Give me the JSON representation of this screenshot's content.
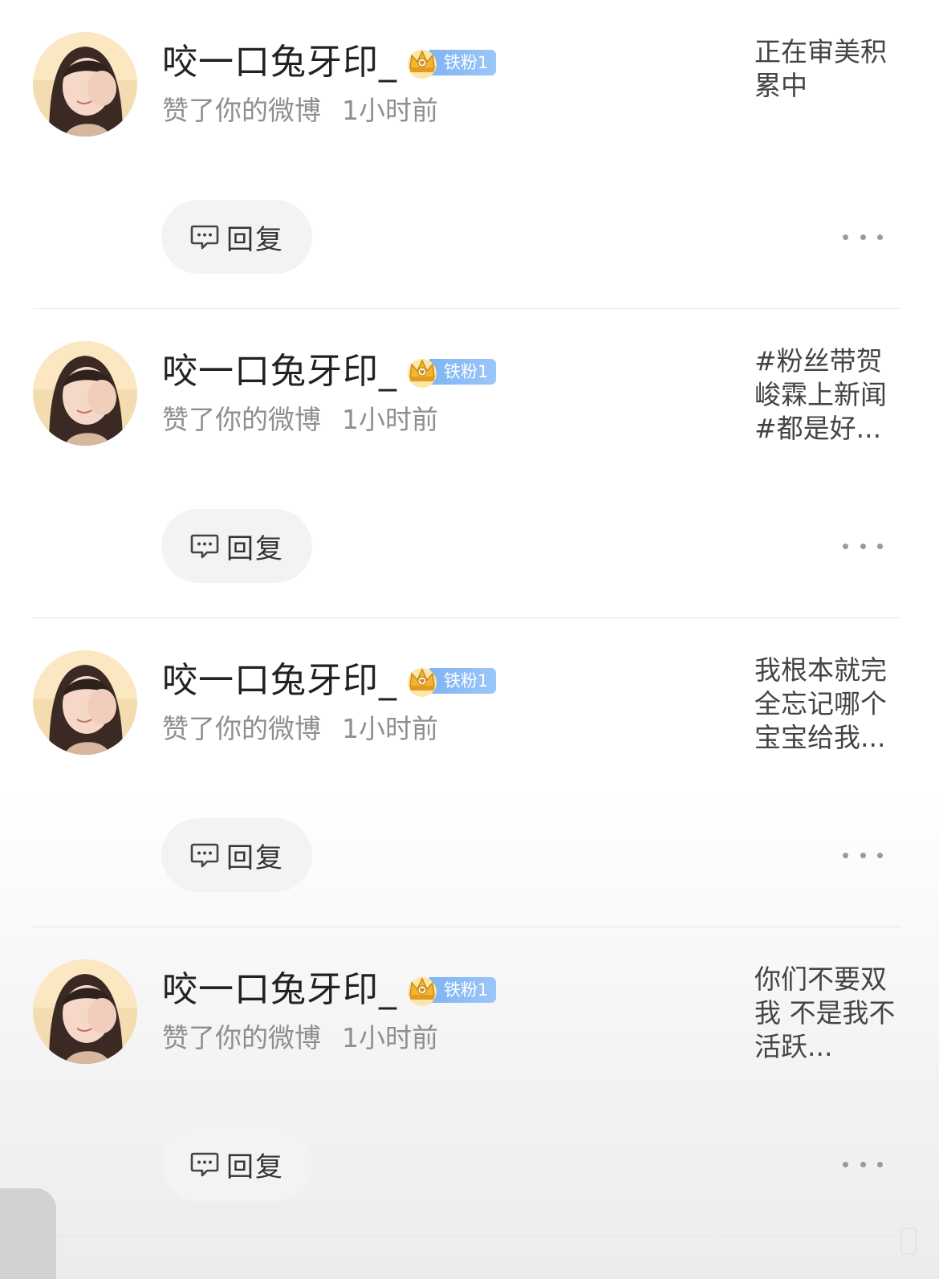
{
  "notifications": [
    {
      "username": "咬一口兔牙印_",
      "badge_label": "铁粉1",
      "action": "赞了你的微博",
      "time": "1小时前",
      "preview": "正在审美积累中",
      "reply_label": "回复"
    },
    {
      "username": "咬一口兔牙印_",
      "badge_label": "铁粉1",
      "action": "赞了你的微博",
      "time": "1小时前",
      "preview": "#粉丝带贺峻霖上新闻#都是好...",
      "reply_label": "回复"
    },
    {
      "username": "咬一口兔牙印_",
      "badge_label": "铁粉1",
      "action": "赞了你的微博",
      "time": "1小时前",
      "preview": "我根本就完全忘记哪个宝宝给我...",
      "reply_label": "回复"
    },
    {
      "username": "咬一口兔牙印_",
      "badge_label": "铁粉1",
      "action": "赞了你的微博",
      "time": "1小时前",
      "preview": "你们不要双我 不是我不活跃...",
      "reply_label": "回复"
    }
  ],
  "icons": {
    "avatar": "user-avatar",
    "badge": "crown-icon",
    "reply": "comment-bubble-icon",
    "more": "more-icon"
  },
  "colors": {
    "badge_blue": "#8dbcf6",
    "crown_gold": "#f2b632",
    "secondary_text": "#8f8f8f",
    "reply_bg": "#f3f3f3"
  }
}
